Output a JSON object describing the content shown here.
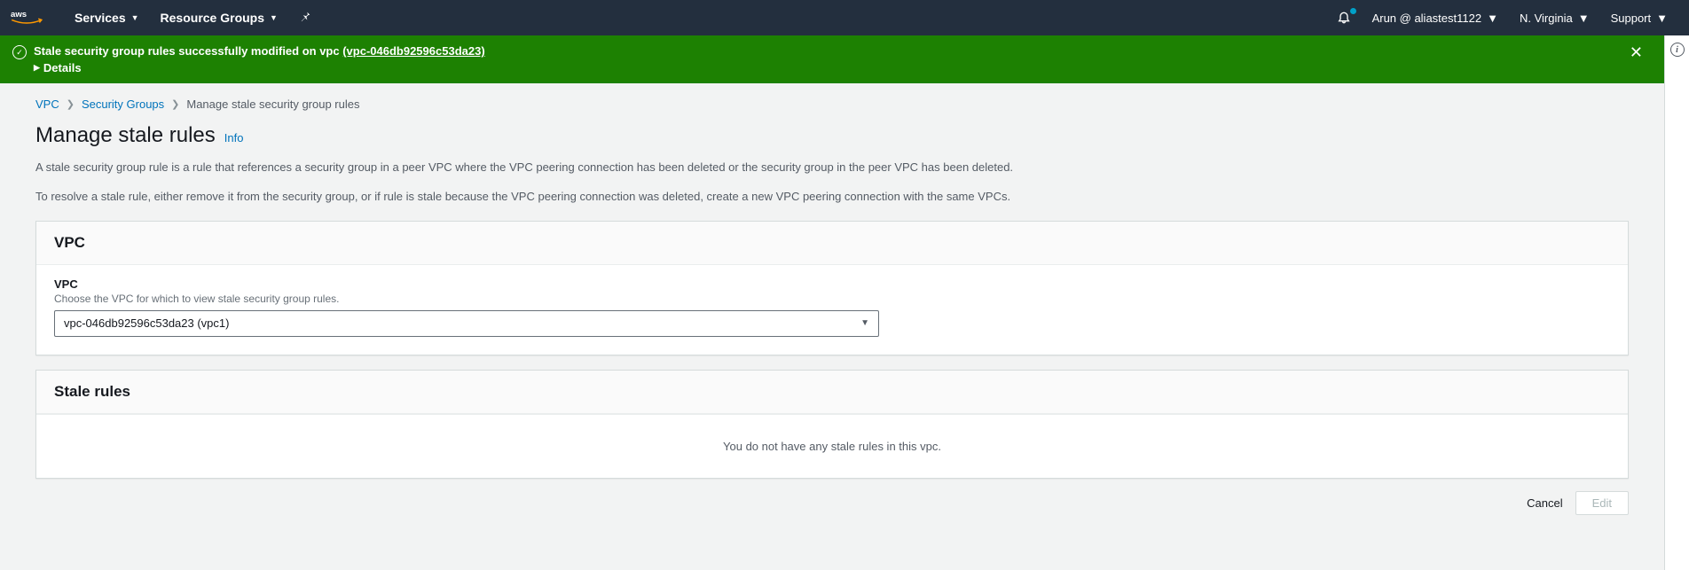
{
  "topnav": {
    "services": "Services",
    "resource_groups": "Resource Groups",
    "user": "Arun @ aliastest1122",
    "region": "N. Virginia",
    "support": "Support"
  },
  "flash": {
    "message": "Stale security group rules successfully modified on vpc ",
    "vpc_link": "(vpc-046db92596c53da23)",
    "details": "Details"
  },
  "breadcrumb": {
    "vpc": "VPC",
    "sg": "Security Groups",
    "current": "Manage stale security group rules"
  },
  "page": {
    "title": "Manage stale rules",
    "info": "Info",
    "desc1": "A stale security group rule is a rule that references a security group in a peer VPC where the VPC peering connection has been deleted or the security group in the peer VPC has been deleted.",
    "desc2": "To resolve a stale rule, either remove it from the security group, or if rule is stale because the VPC peering connection was deleted, create a new VPC peering connection with the same VPCs."
  },
  "vpc_panel": {
    "header": "VPC",
    "label": "VPC",
    "help": "Choose the VPC for which to view stale security group rules.",
    "selected": "vpc-046db92596c53da23 (vpc1)"
  },
  "stale_panel": {
    "header": "Stale rules",
    "empty": "You do not have any stale rules in this vpc."
  },
  "actions": {
    "cancel": "Cancel",
    "edit": "Edit"
  }
}
